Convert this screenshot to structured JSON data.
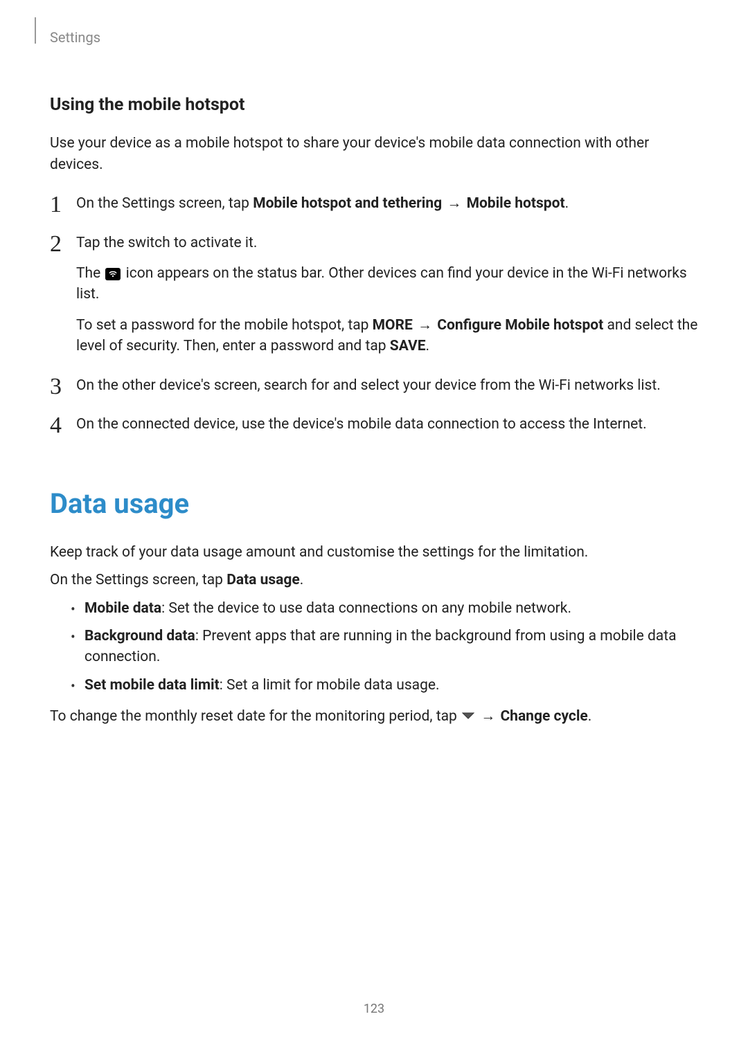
{
  "breadcrumb": "Settings",
  "section1": {
    "heading": "Using the mobile hotspot",
    "intro": "Use your device as a mobile hotspot to share your device's mobile data connection with other devices.",
    "steps": [
      {
        "pre1": "On the Settings screen, tap ",
        "bold1": "Mobile hotspot and tethering",
        "arrow1": " → ",
        "bold2": "Mobile hotspot",
        "post1": "."
      },
      {
        "line1": "Tap the switch to activate it.",
        "line2a": "The ",
        "line2b": " icon appears on the status bar. Other devices can find your device in the Wi-Fi networks list.",
        "line3a": "To set a password for the mobile hotspot, tap ",
        "line3_more": "MORE",
        "line3_arrow": " → ",
        "line3_conf": "Configure Mobile hotspot",
        "line3b": " and select the level of security. Then, enter a password and tap ",
        "line3_save": "SAVE",
        "line3c": "."
      },
      {
        "text": "On the other device's screen, search for and select your device from the Wi-Fi networks list."
      },
      {
        "text": "On the connected device, use the device's mobile data connection to access the Internet."
      }
    ]
  },
  "section2": {
    "heading": "Data usage",
    "para1": "Keep track of your data usage amount and customise the settings for the limitation.",
    "para2a": "On the Settings screen, tap ",
    "para2_bold": "Data usage",
    "para2b": ".",
    "bullets": [
      {
        "bold": "Mobile data",
        "rest": ": Set the device to use data connections on any mobile network."
      },
      {
        "bold": "Background data",
        "rest": ": Prevent apps that are running in the background from using a mobile data connection."
      },
      {
        "bold": "Set mobile data limit",
        "rest": ": Set a limit for mobile data usage."
      }
    ],
    "para3a": "To change the monthly reset date for the monitoring period, tap ",
    "para3_arrow": " → ",
    "para3_bold": "Change cycle",
    "para3b": "."
  },
  "pageNumber": "123"
}
